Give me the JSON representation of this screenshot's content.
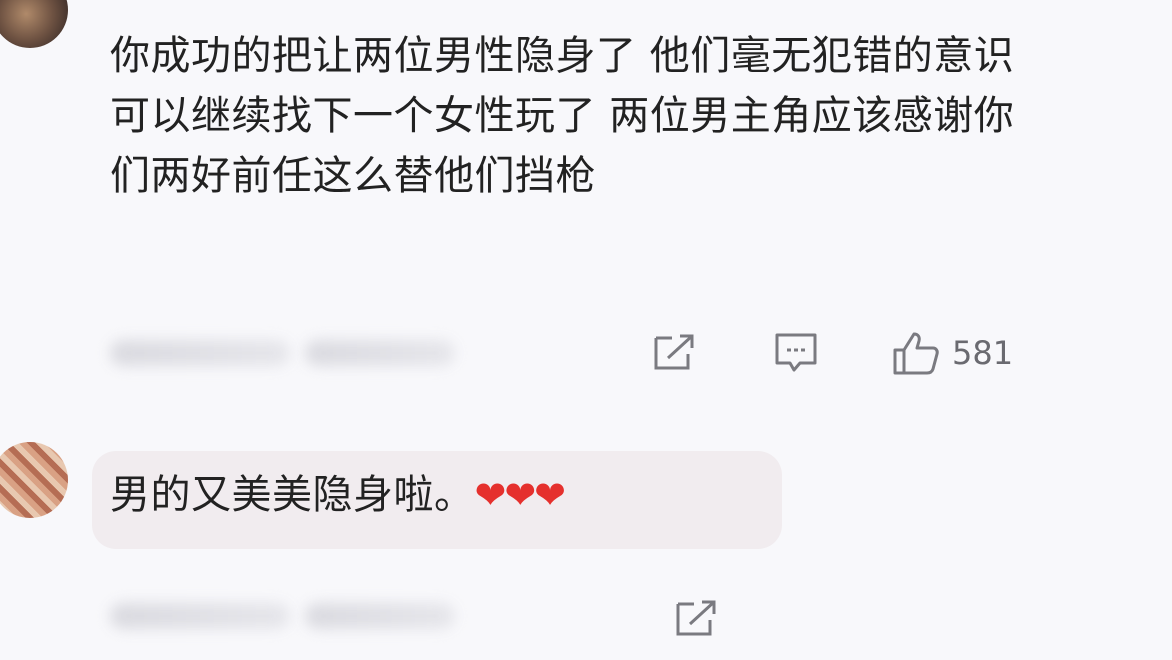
{
  "comments": [
    {
      "avatar_icon": "user-avatar-icon",
      "text": "你成功的把让两位男性隐身了 他们毫无犯错的意识可以继续找下一个女性玩了 两位男主角应该感谢你们两好前任这么替他们挡枪",
      "actions": {
        "share_icon": "share-icon",
        "reply_icon": "comment-icon",
        "like_icon": "thumbs-up-icon",
        "like_count": "581"
      }
    },
    {
      "avatar_icon": "user-avatar-icon",
      "text": "男的又美美隐身啦。",
      "emoji": "❤❤❤",
      "actions": {
        "share_icon": "share-icon"
      }
    }
  ],
  "colors": {
    "background": "#f8f8fb",
    "text": "#222222",
    "icon": "#7a7a80",
    "heart": "#e5302d",
    "bubble": "#f1ecef"
  }
}
